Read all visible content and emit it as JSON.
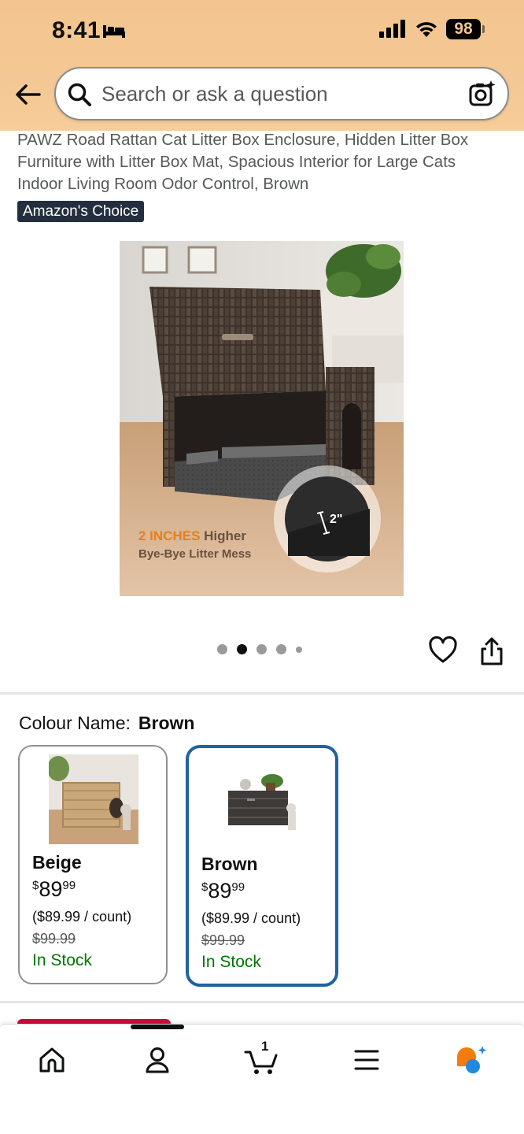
{
  "status_bar": {
    "time": "8:41",
    "battery": "98"
  },
  "search": {
    "placeholder": "Search or ask a question"
  },
  "product": {
    "title": "PAWZ Road Rattan Cat Litter Box Enclosure, Hidden Litter Box Furniture with Litter Box Mat, Spacious Interior for Large Cats Indoor Living Room Odor Control, Brown",
    "badge": "Amazon's Choice",
    "image_caption_highlight": "2 INCHES",
    "image_caption_rest": " Higher",
    "image_caption_line2": "Bye-Bye Litter Mess",
    "image_measure": "2\""
  },
  "carousel": {
    "total": 5,
    "active_index": 1
  },
  "colour": {
    "label": "Colour Name:",
    "selected": "Brown",
    "options": [
      {
        "name": "Beige",
        "currency": "$",
        "price_whole": "89",
        "price_fraction": "99",
        "unit_price": "($89.99 / count)",
        "was_price": "$99.99",
        "stock": "In Stock",
        "selected": false
      },
      {
        "name": "Brown",
        "currency": "$",
        "price_whole": "89",
        "price_fraction": "99",
        "unit_price": "($89.99 / count)",
        "was_price": "$99.99",
        "stock": "In Stock",
        "selected": true
      }
    ]
  },
  "bottom_nav": {
    "items": [
      "home-icon",
      "account-icon",
      "cart-icon",
      "menu-icon",
      "rufus-icon"
    ],
    "cart_count": "1"
  },
  "colors": {
    "header": "#f3c48f",
    "selected_border": "#2162a1",
    "in_stock": "#007600",
    "badge_bg": "#232f3e",
    "accent_orange": "#f47c0e",
    "accent_blue": "#2189e0"
  }
}
